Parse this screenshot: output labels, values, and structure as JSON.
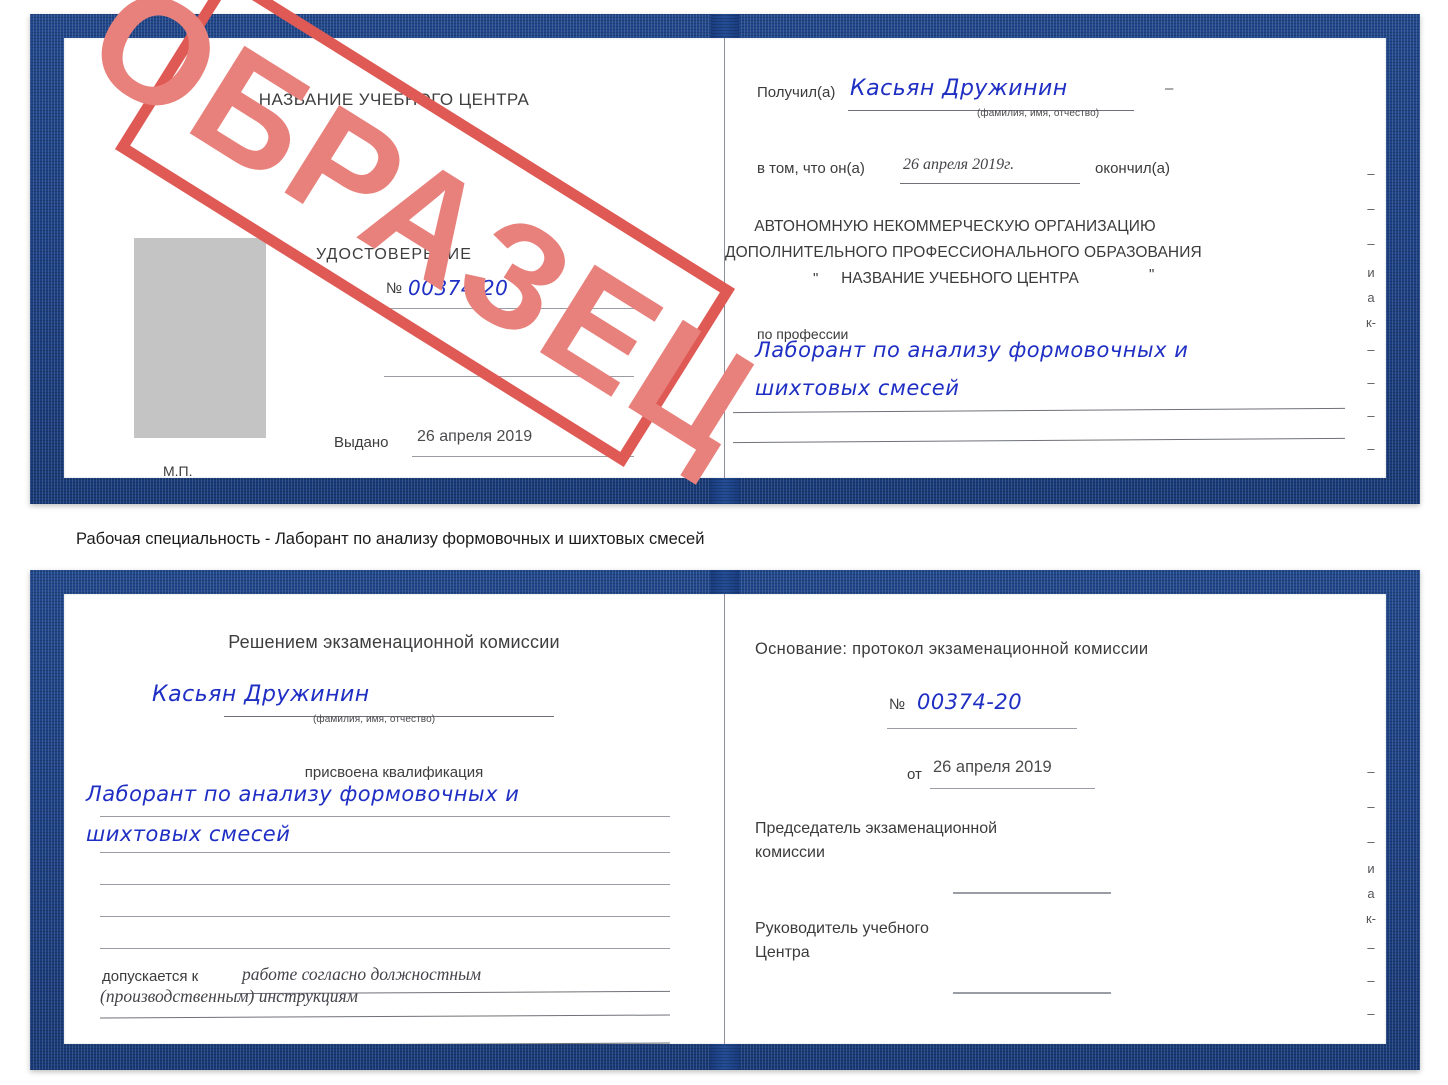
{
  "document": {
    "type": "Удостоверение",
    "caption": "Рабочая специальность - Лаборант по анализу формовочных и шихтовых смесей",
    "stamp_label": "ОБРАЗЕЦ",
    "colors": {
      "cover_blue": "#1d4185",
      "stamp_red": "#df5a55",
      "stamp_fill": "#e8817c",
      "handwriting_blue": "#1f2fc4",
      "photo_placeholder": "#c4c4c4"
    }
  },
  "cert_top": {
    "left_page": {
      "center_name": "НАЗВАНИЕ УЧЕБНОГО ЦЕНТРА",
      "doc_title": "УДОСТОВЕРЕНИЕ",
      "number_symbol": "№",
      "number_value": "00374-20",
      "issued_label": "Выдано",
      "issued_date": "26 апреля 2019",
      "seal_label": "М.П."
    },
    "right_page": {
      "received_label": "Получил(а)",
      "received_name": "Касьян Дружинин",
      "name_hint": "(фамилия, имя, отчество)",
      "that_he_label": "в том, что он(а)",
      "completion_date": "26 апреля 2019г.",
      "finished_label": "окончил(а)",
      "org_line1": "АВТОНОМНУЮ НЕКОММЕРЧЕСКУЮ ОРГАНИЗАЦИЮ",
      "org_line2": "ДОПОЛНИТЕЛЬНОГО ПРОФЕССИОНАЛЬНОГО ОБРАЗОВАНИЯ",
      "org_quote_open": "\"",
      "org_name": "НАЗВАНИЕ УЧЕБНОГО ЦЕНТРА",
      "org_quote_close": "\"",
      "profession_label": "по профессии",
      "profession_line1": "Лаборант по анализу формовочных и",
      "profession_line2": "шихтовых смесей",
      "edge_glyphs": [
        "–",
        "–",
        "–",
        "и",
        "а",
        "к-",
        "–",
        "–",
        "–",
        "–"
      ]
    }
  },
  "cert_bottom": {
    "left_page": {
      "heading": "Решением экзаменационной комиссии",
      "name": "Касьян Дружинин",
      "name_hint": "(фамилия, имя, отчество)",
      "qualification_label": "присвоена квалификация",
      "qualification_line1": "Лаборант по анализу формовочных и",
      "qualification_line2": "шихтовых смесей",
      "allowed_label": "допускается к",
      "allowed_line1": "работе согласно должностным",
      "allowed_line2": "(производственным) инструкциям"
    },
    "right_page": {
      "basis_label": "Основание: протокол экзаменационной комиссии",
      "number_symbol": "№",
      "number_value": "00374-20",
      "date_label": "от",
      "date_value": "26 апреля 2019",
      "chairman_line1": "Председатель экзаменационной",
      "chairman_line2": "комиссии",
      "director_line1": "Руководитель учебного",
      "director_line2": "Центра",
      "edge_glyphs": [
        "–",
        "–",
        "–",
        "и",
        "а",
        "к-",
        "–",
        "–",
        "–",
        "–"
      ]
    }
  }
}
